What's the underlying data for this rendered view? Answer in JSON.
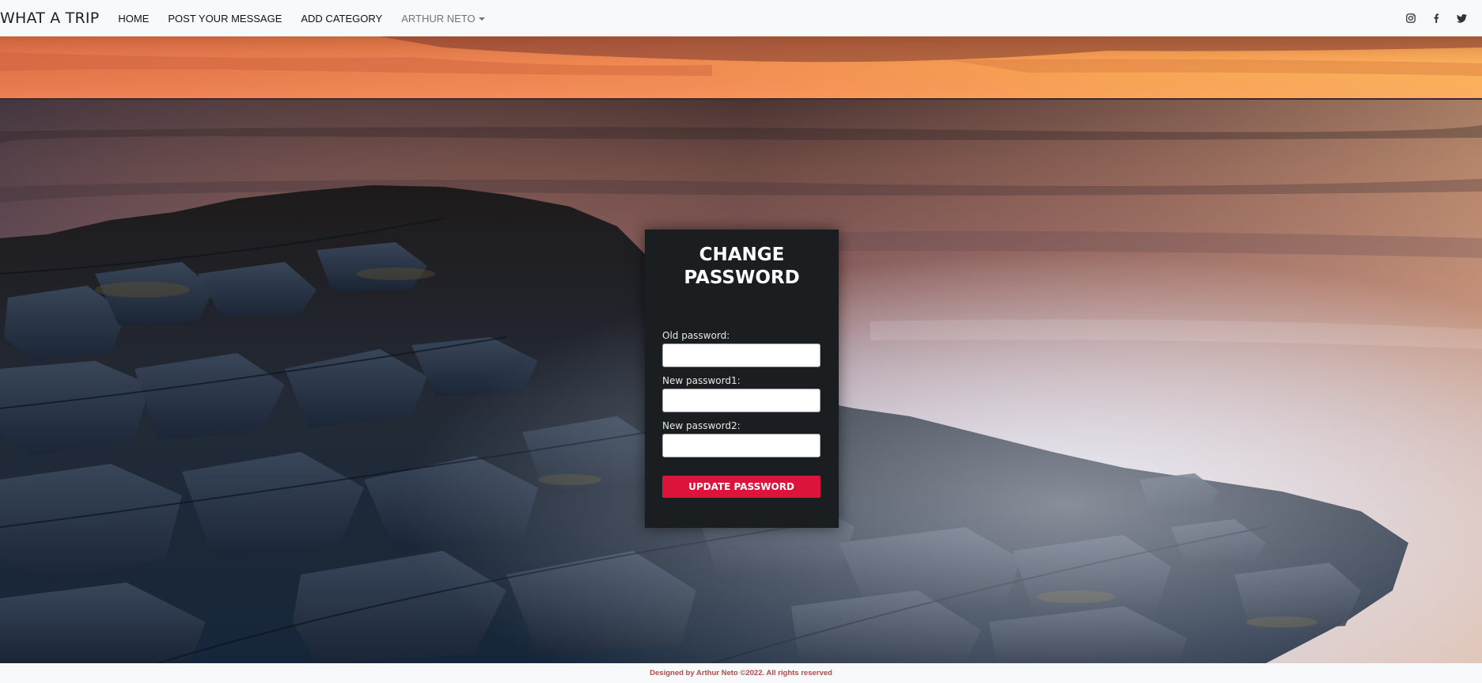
{
  "navbar": {
    "brand": "WHAT A TRIP",
    "links": [
      "HOME",
      "POST YOUR MESSAGE",
      "ADD CATEGORY"
    ],
    "user_menu": "ARTHUR NETO",
    "social_icons": [
      "instagram-icon",
      "facebook-icon",
      "twitter-icon"
    ]
  },
  "form": {
    "title_line1": "CHANGE",
    "title_line2": "PASSWORD",
    "fields": [
      {
        "label": "Old password:",
        "value": ""
      },
      {
        "label": "New password1:",
        "value": ""
      },
      {
        "label": "New password2:",
        "value": ""
      }
    ],
    "submit_label": "UPDATE PASSWORD"
  },
  "footer": {
    "text": "Designed by Arthur Neto ©2022. All rights reserved"
  },
  "colors": {
    "accent": "#dc143c",
    "card_bg": "#1b1e21",
    "navbar_bg": "#f8f9fa",
    "footer_text": "#b24b4b"
  }
}
